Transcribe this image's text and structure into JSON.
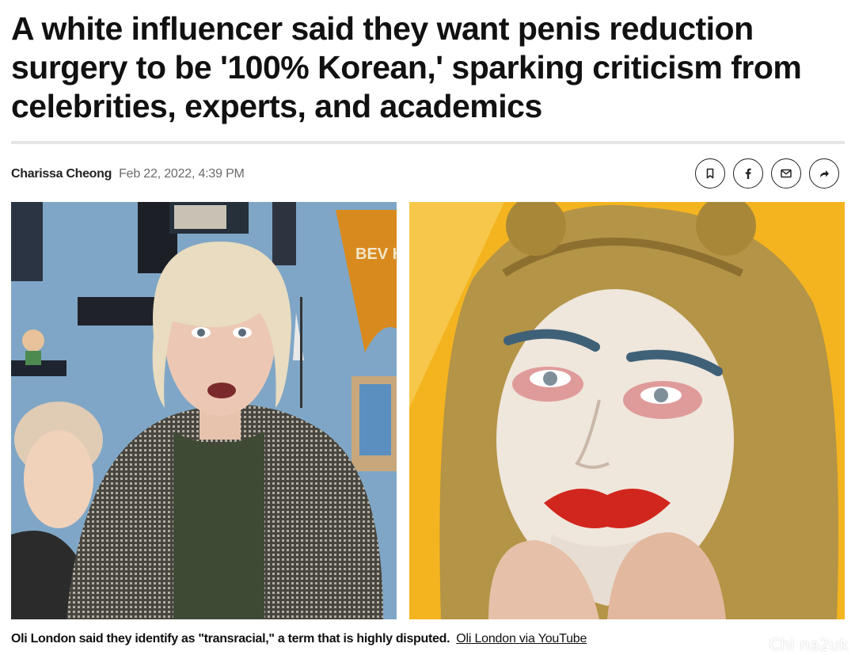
{
  "article": {
    "headline": "A white influencer said they want penis reduction surgery to be '100% Korean,' sparking criticism from celebrities, experts, and academics",
    "author": "Charissa Cheong",
    "date": "Feb 22, 2022, 4:39 PM"
  },
  "actions": [
    {
      "name": "bookmark",
      "icon": "bookmark-icon"
    },
    {
      "name": "facebook",
      "icon": "facebook-icon"
    },
    {
      "name": "email",
      "icon": "email-icon"
    },
    {
      "name": "share",
      "icon": "share-icon"
    }
  ],
  "images": {
    "left_sign_text": "BEV HI"
  },
  "caption": {
    "text": "Oli London said they identify as \"transracial,\" a term that is highly disputed.",
    "credit": "Oli London via YouTube"
  },
  "watermark": "Chi na2uk",
  "colors": {
    "text": "#111111",
    "muted": "#6b6b6b",
    "rule": "#e6e6e6",
    "right_bg": "#f3b323"
  }
}
